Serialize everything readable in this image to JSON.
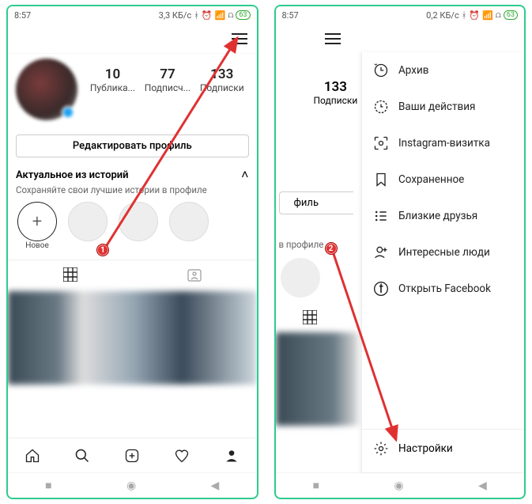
{
  "status": {
    "time": "8:57",
    "net1": "3,3 КБ/с",
    "net2": "0,2 КБ/с",
    "battery": "63"
  },
  "profile": {
    "stats": {
      "posts": {
        "num": "10",
        "label": "Публика..."
      },
      "followers": {
        "num": "77",
        "label": "Подписч..."
      },
      "following": {
        "num": "133",
        "label": "Подписки"
      }
    },
    "edit_label": "Редактировать профиль",
    "highlights_title": "Актуальное из историй",
    "highlights_sub": "Сохраняйте свои лучшие истории в профиле",
    "new_label": "Новое"
  },
  "phone2": {
    "stat_following": {
      "num": "133",
      "label": "Подписки"
    },
    "edit_frag": "филь",
    "hl_frag": "в профиле"
  },
  "menu": {
    "archive": "Архив",
    "activity": "Ваши действия",
    "nametag": "Instagram-визитка",
    "saved": "Сохраненное",
    "close_friends": "Близкие друзья",
    "discover": "Интересные люди",
    "facebook": "Открыть Facebook",
    "settings": "Настройки"
  },
  "badges": {
    "b1": "1",
    "b2": "2"
  }
}
